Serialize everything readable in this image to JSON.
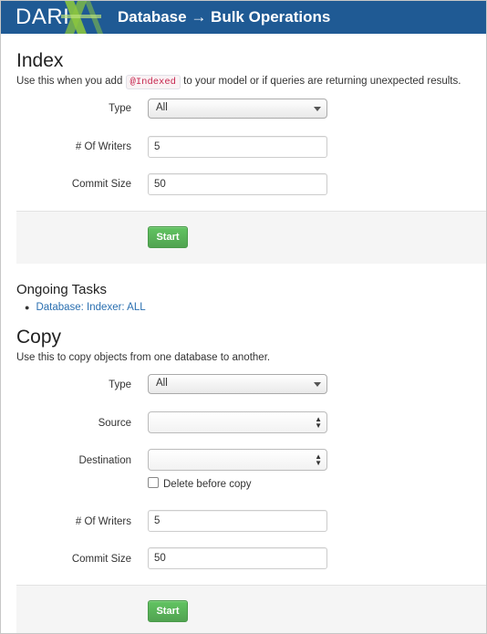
{
  "header": {
    "logo": "DARI",
    "title": "Database → Bulk Operations"
  },
  "index": {
    "title": "Index",
    "description_before": "Use this when you add ",
    "code": "@Indexed",
    "description_after": " to your model or if queries are returning unexpected results.",
    "type_label": "Type",
    "type_value": "All",
    "writers_label": "# Of Writers",
    "writers_value": "5",
    "commit_label": "Commit Size",
    "commit_value": "50",
    "start_label": "Start"
  },
  "ongoing": {
    "title": "Ongoing Tasks",
    "items": [
      "Database: Indexer: ALL"
    ]
  },
  "copy": {
    "title": "Copy",
    "description": "Use this to copy objects from one database to another.",
    "type_label": "Type",
    "type_value": "All",
    "source_label": "Source",
    "source_value": "",
    "destination_label": "Destination",
    "destination_value": "",
    "delete_label": "Delete before copy",
    "delete_checked": false,
    "writers_label": "# Of Writers",
    "writers_value": "5",
    "commit_label": "Commit Size",
    "commit_value": "50",
    "start_label": "Start"
  },
  "colors": {
    "header_bg": "#1f5a94",
    "accent_green": "#8ac43f",
    "button_green": "#5bb75b",
    "link": "#2a6fb0"
  }
}
